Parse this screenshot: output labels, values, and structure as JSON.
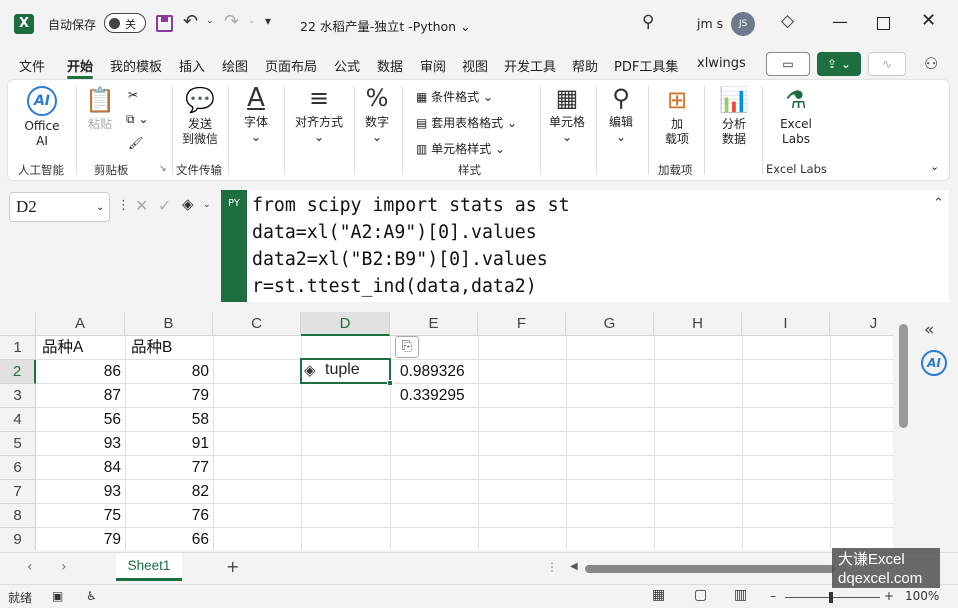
{
  "titlebar": {
    "app_logo": "X",
    "autosave_label": "自动保存",
    "autosave_state": "关",
    "doc_title": "22 水稻产量-独立t -Python ⌄",
    "user_name": "jm s",
    "user_initials": "JS"
  },
  "menu": {
    "tabs": [
      "文件",
      "开始",
      "我的模板",
      "插入",
      "绘图",
      "页面布局",
      "公式",
      "数据",
      "审阅",
      "视图",
      "开发工具",
      "帮助",
      "PDF工具集",
      "xlwings"
    ],
    "active_tab": "开始"
  },
  "ribbon": {
    "office_ai_line1": "Office",
    "office_ai_line2": "AI",
    "ai_badge": "AI",
    "paste": "粘贴",
    "send_line1": "发送",
    "send_line2": "到微信",
    "font": "字体",
    "align": "对齐方式",
    "number": "数字",
    "conditional_format": "条件格式",
    "table_format": "套用表格格式",
    "cell_style": "单元格样式",
    "cells": "单元格",
    "editing": "编辑",
    "addin_line1": "加",
    "addin_line2": "载项",
    "analyze_line1": "分析",
    "analyze_line2": "数据",
    "excel_labs_line1": "Excel",
    "excel_labs_line2": "Labs",
    "groups": {
      "ai": "人工智能",
      "clipboard": "剪贴板",
      "transfer": "文件传输",
      "style": "样式",
      "addins": "加载项",
      "excel_labs": "Excel Labs"
    }
  },
  "formula_bar": {
    "name_box": "D2",
    "py_badge": "PY",
    "code": [
      "from scipy import stats as st",
      "data=xl(\"A2:A9\")[0].values",
      "data2=xl(\"B2:B9\")[0].values",
      "r=st.ttest_ind(data,data2)"
    ]
  },
  "grid": {
    "columns": [
      "A",
      "B",
      "C",
      "D",
      "E",
      "F",
      "G",
      "H",
      "I",
      "J"
    ],
    "selected_column": "D",
    "rows": [
      "1",
      "2",
      "3",
      "4",
      "5",
      "6",
      "7",
      "8",
      "9"
    ],
    "selected_row": "2",
    "headers": {
      "A1": "品种A",
      "B1": "品种B"
    },
    "colA": [
      "86",
      "87",
      "56",
      "93",
      "84",
      "93",
      "75",
      "79"
    ],
    "colB": [
      "80",
      "79",
      "58",
      "91",
      "77",
      "82",
      "76",
      "66"
    ],
    "D2": "tuple",
    "E2": "0.989326",
    "E3": "0.339295"
  },
  "sheets": {
    "active": "Sheet1",
    "add": "+"
  },
  "status": {
    "ready": "就绪",
    "zoom": "100%"
  },
  "watermark": {
    "line1": "大谦Excel",
    "line2": "dqexcel.com"
  },
  "colors": {
    "accent": "#1d6f42",
    "ai_blue": "#2b7cd3"
  }
}
